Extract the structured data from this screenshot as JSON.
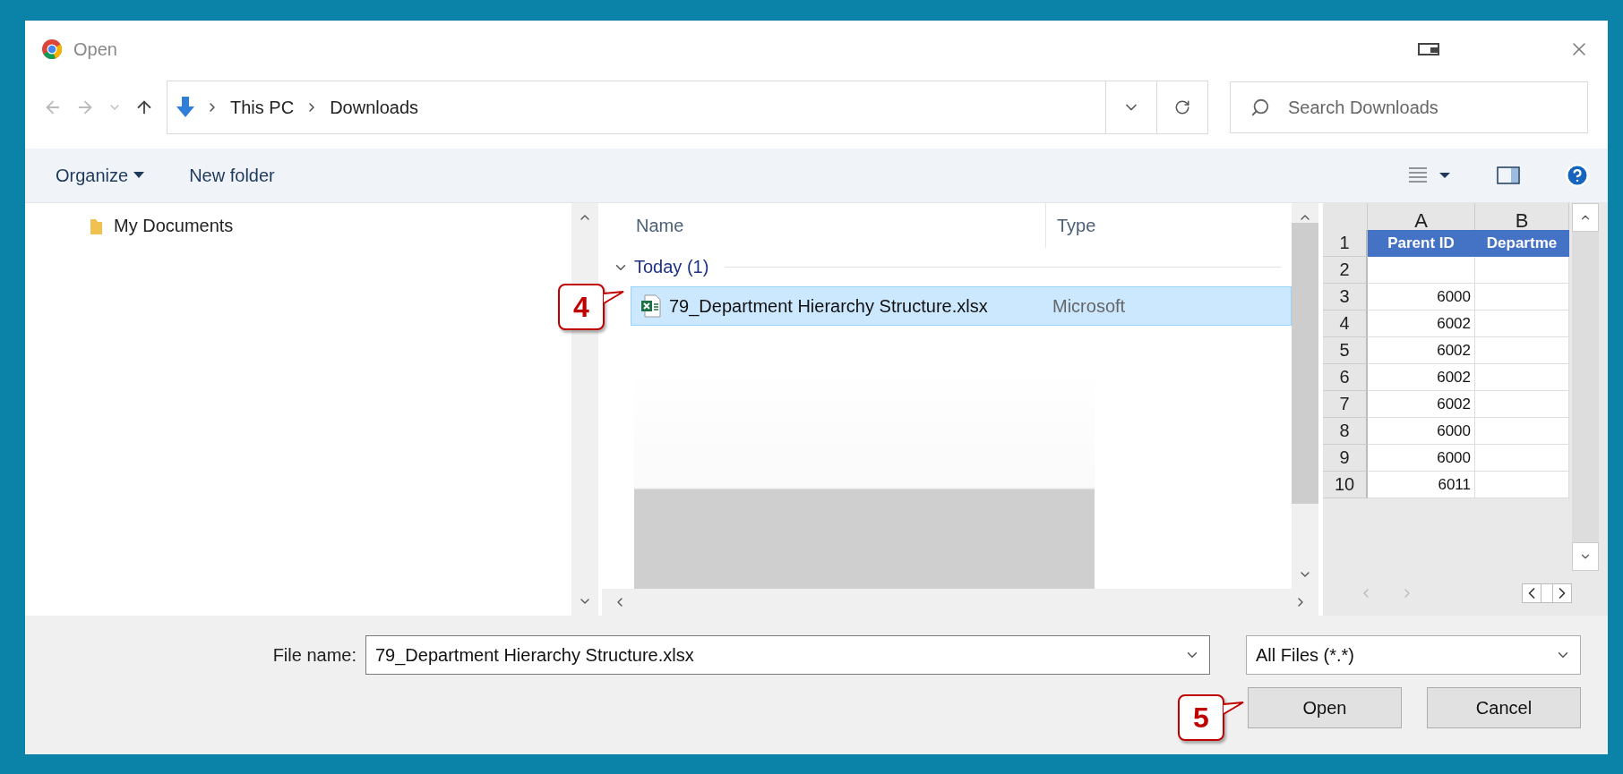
{
  "window": {
    "title": "Open"
  },
  "nav": {
    "path": [
      "This PC",
      "Downloads"
    ],
    "search_placeholder": "Search Downloads"
  },
  "toolbar": {
    "organize": "Organize",
    "new_folder": "New folder"
  },
  "sidebar": {
    "items": [
      {
        "label": "My Documents",
        "selected": false
      }
    ]
  },
  "file_list": {
    "columns": [
      "Name",
      "Type"
    ],
    "groups": [
      {
        "label": "Today (1)",
        "expanded": true,
        "files": [
          {
            "name": "79_Department Hierarchy Structure.xlsx",
            "type": "Microsoft",
            "selected": true
          }
        ]
      }
    ]
  },
  "preview": {
    "columns": [
      "A",
      "B"
    ],
    "rows": [
      {
        "number": "1",
        "kind": "header",
        "cells": [
          "Parent ID",
          "Departme"
        ]
      },
      {
        "number": "2",
        "kind": "data",
        "cells": [
          "",
          ""
        ]
      },
      {
        "number": "3",
        "kind": "data",
        "cells": [
          "6000",
          ""
        ]
      },
      {
        "number": "4",
        "kind": "data",
        "cells": [
          "6002",
          ""
        ]
      },
      {
        "number": "5",
        "kind": "data",
        "cells": [
          "6002",
          ""
        ]
      },
      {
        "number": "6",
        "kind": "data",
        "cells": [
          "6002",
          ""
        ]
      },
      {
        "number": "7",
        "kind": "data",
        "cells": [
          "6002",
          ""
        ]
      },
      {
        "number": "8",
        "kind": "data",
        "cells": [
          "6000",
          ""
        ]
      },
      {
        "number": "9",
        "kind": "data",
        "cells": [
          "6000",
          ""
        ]
      },
      {
        "number": "10",
        "kind": "data",
        "cells": [
          "6011",
          ""
        ]
      }
    ]
  },
  "footer": {
    "file_name_label": "File name:",
    "file_name": "79_Department Hierarchy Structure.xlsx",
    "filter": "All Files (*.*)",
    "buttons": [
      "Open",
      "Cancel"
    ]
  },
  "callouts": [
    {
      "label": "4"
    },
    {
      "label": "5"
    }
  ]
}
